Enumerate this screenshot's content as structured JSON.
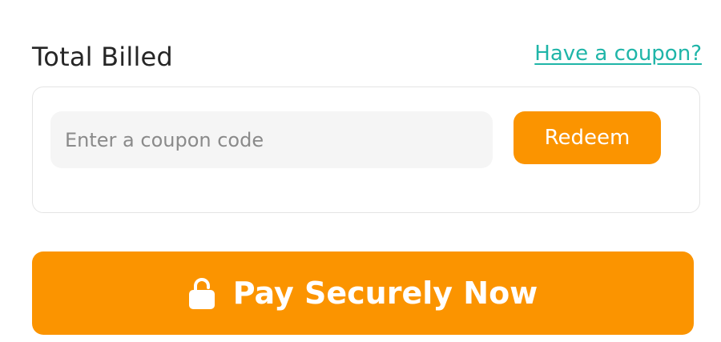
{
  "header": {
    "title": "Total Billed",
    "coupon_link": "Have a coupon?"
  },
  "coupon": {
    "placeholder": "Enter a coupon code",
    "value": "",
    "redeem_label": "Redeem"
  },
  "pay": {
    "label": "Pay Securely Now",
    "icon": "lock-icon"
  },
  "colors": {
    "accent": "#fb9400",
    "link": "#1fb5a8",
    "text": "#262626",
    "input_bg": "#f5f5f5",
    "border": "#e4e4e4"
  }
}
